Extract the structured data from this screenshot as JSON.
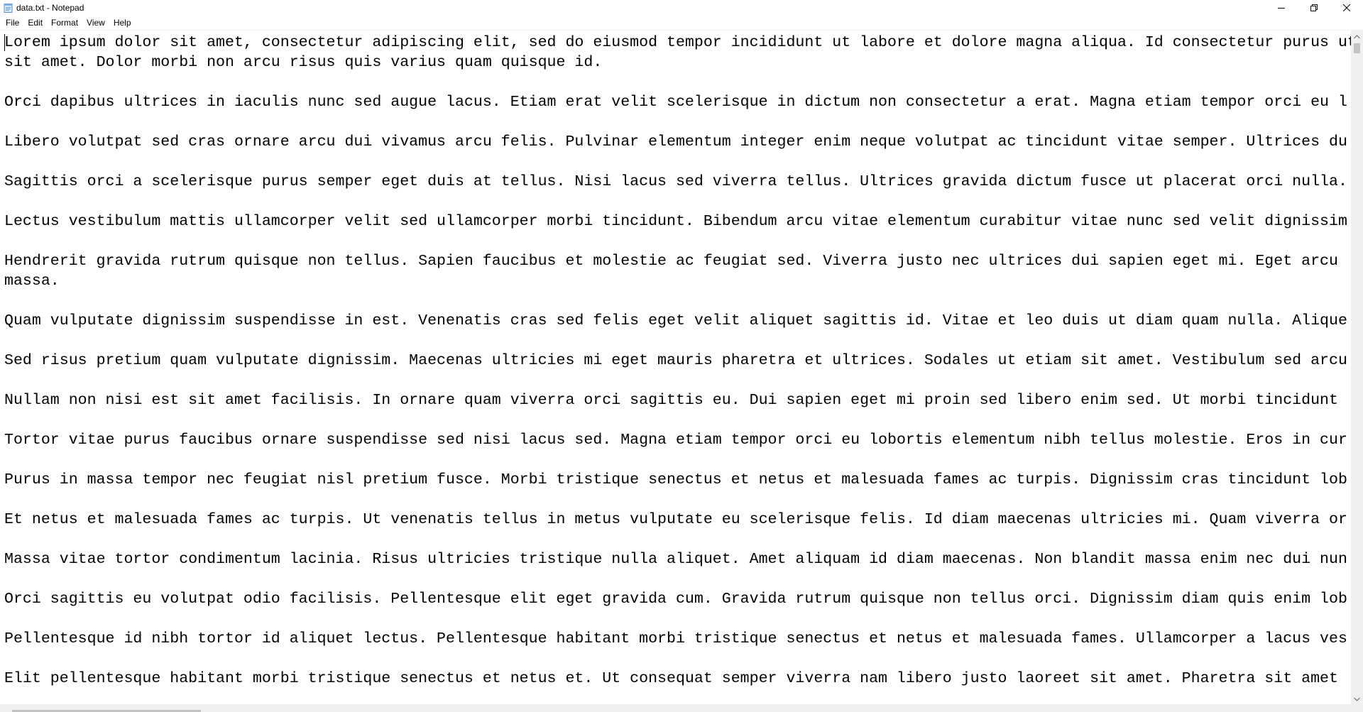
{
  "window": {
    "title": "data.txt - Notepad",
    "icon": "notepad-icon"
  },
  "menu": {
    "items": [
      "File",
      "Edit",
      "Format",
      "View",
      "Help"
    ]
  },
  "controls": {
    "minimize_icon": "minimize-icon",
    "restore_icon": "restore-icon",
    "close_icon": "close-icon"
  },
  "editor": {
    "lines": [
      "Lorem ipsum dolor sit amet, consectetur adipiscing elit, sed do eiusmod tempor incididunt ut labore et dolore magna aliqua. Id consectetur purus ut",
      "sit amet. Dolor morbi non arcu risus quis varius quam quisque id.",
      "",
      "Orci dapibus ultrices in iaculis nunc sed augue lacus. Etiam erat velit scelerisque in dictum non consectetur a erat. Magna etiam tempor orci eu l",
      "",
      "Libero volutpat sed cras ornare arcu dui vivamus arcu felis. Pulvinar elementum integer enim neque volutpat ac tincidunt vitae semper. Ultrices du",
      "",
      "Sagittis orci a scelerisque purus semper eget duis at tellus. Nisi lacus sed viverra tellus. Ultrices gravida dictum fusce ut placerat orci nulla.",
      "",
      "Lectus vestibulum mattis ullamcorper velit sed ullamcorper morbi tincidunt. Bibendum arcu vitae elementum curabitur vitae nunc sed velit dignissim",
      "",
      "Hendrerit gravida rutrum quisque non tellus. Sapien faucibus et molestie ac feugiat sed. Viverra justo nec ultrices dui sapien eget mi. Eget arcu",
      "massa.",
      "",
      "Quam vulputate dignissim suspendisse in est. Venenatis cras sed felis eget velit aliquet sagittis id. Vitae et leo duis ut diam quam nulla. Alique",
      "",
      "Sed risus pretium quam vulputate dignissim. Maecenas ultricies mi eget mauris pharetra et ultrices. Sodales ut etiam sit amet. Vestibulum sed arcu",
      "",
      "Nullam non nisi est sit amet facilisis. In ornare quam viverra orci sagittis eu. Dui sapien eget mi proin sed libero enim sed. Ut morbi tincidunt",
      "",
      "Tortor vitae purus faucibus ornare suspendisse sed nisi lacus sed. Magna etiam tempor orci eu lobortis elementum nibh tellus molestie. Eros in cur",
      "",
      "Purus in massa tempor nec feugiat nisl pretium fusce. Morbi tristique senectus et netus et malesuada fames ac turpis. Dignissim cras tincidunt lob",
      "",
      "Et netus et malesuada fames ac turpis. Ut venenatis tellus in metus vulputate eu scelerisque felis. Id diam maecenas ultricies mi. Quam viverra or",
      "",
      "Massa vitae tortor condimentum lacinia. Risus ultricies tristique nulla aliquet. Amet aliquam id diam maecenas. Non blandit massa enim nec dui nun",
      "",
      "Orci sagittis eu volutpat odio facilisis. Pellentesque elit eget gravida cum. Gravida rutrum quisque non tellus orci. Dignissim diam quis enim lob",
      "",
      "Pellentesque id nibh tortor id aliquet lectus. Pellentesque habitant morbi tristique senectus et netus et malesuada fames. Ullamcorper a lacus ves",
      "",
      "Elit pellentesque habitant morbi tristique senectus et netus et. Ut consequat semper viverra nam libero justo laoreet sit amet. Pharetra sit amet"
    ]
  },
  "scrollbars": {
    "up_icon": "scroll-up-arrow-icon",
    "down_icon": "scroll-down-arrow-icon"
  }
}
